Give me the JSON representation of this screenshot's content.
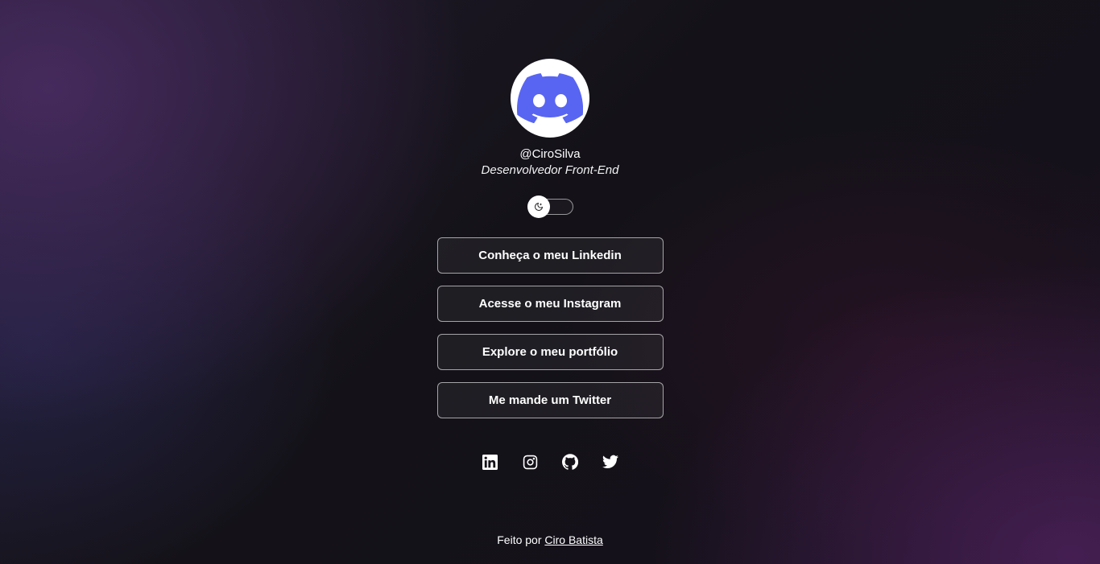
{
  "profile": {
    "handle": "@CiroSilva",
    "subtitle": "Desenvolvedor Front-End",
    "avatar_icon": "discord-logo-icon",
    "avatar_color": "#5865F2"
  },
  "theme_switch": {
    "icon": "moon-icon",
    "state": "dark"
  },
  "links": [
    {
      "label": "Conheça o meu Linkedin"
    },
    {
      "label": "Acesse o meu Instagram"
    },
    {
      "label": "Explore o meu portfólio"
    },
    {
      "label": "Me mande um Twitter"
    }
  ],
  "social": [
    {
      "icon": "linkedin-icon"
    },
    {
      "icon": "instagram-icon"
    },
    {
      "icon": "github-icon"
    },
    {
      "icon": "twitter-icon"
    }
  ],
  "footer": {
    "prefix": "Feito por",
    "author": "Ciro Batista"
  }
}
